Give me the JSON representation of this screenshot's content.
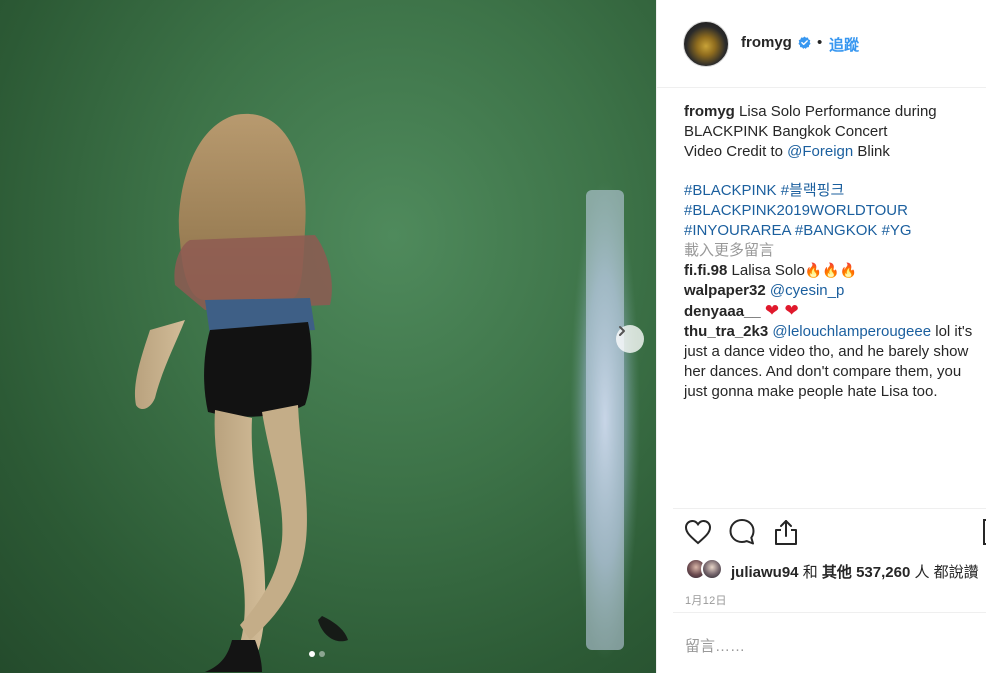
{
  "post": {
    "next_button_icon": "chevron-right-icon",
    "slide_count": 2,
    "active_slide": 1
  },
  "header": {
    "username": "fromyg",
    "verified_icon": "verified-badge-icon",
    "separator": "•",
    "follow_label": "追蹤"
  },
  "caption": {
    "username": "fromyg",
    "line1": "Lisa Solo Performance during",
    "line2": "BLACKPINK Bangkok Concert",
    "line3_prefix": "Video Credit to",
    "mention": "@Foreign",
    "line3_suffix": "Blink",
    "hashtags_line1": [
      "#BLACKPINK",
      "#블랙핑크"
    ],
    "hashtags_line2": [
      "#BLACKPINK2019WORLDTOUR"
    ],
    "hashtags_line3": [
      "#INYOURAREA",
      "#BANGKOK",
      "#YG"
    ]
  },
  "load_more_label": "載入更多留言",
  "comments": [
    {
      "username": "fi.fi.98",
      "text": "Lalisa Solo",
      "emoji": "🔥🔥🔥"
    },
    {
      "username": "walpaper32",
      "mention": "@cyesin_p"
    },
    {
      "username": "denyaaa__",
      "emoji": "❤ ❤"
    },
    {
      "username": "thu_tra_2k3",
      "mention": "@lelouchlamperougeee",
      "text": "lol it's just a dance video tho, and he barely show her dances. And don't compare them, you just gonna make people hate Lisa too."
    }
  ],
  "actions": {
    "like_icon": "heart-outline-icon",
    "comment_icon": "comment-bubble-icon",
    "share_icon": "share-upload-icon",
    "save_icon": "bookmark-icon"
  },
  "likes": {
    "username": "juliawu94",
    "connector": "和",
    "others_label": "其他",
    "count": "537,260",
    "suffix": "人 都說讚"
  },
  "date": "1月12日",
  "comment_input": {
    "placeholder": "留言……"
  },
  "colors": {
    "link": "#1b5f9e",
    "follow": "#3897f0",
    "muted": "#999999",
    "verified": "#3897f0",
    "heart": "#e0192c"
  }
}
